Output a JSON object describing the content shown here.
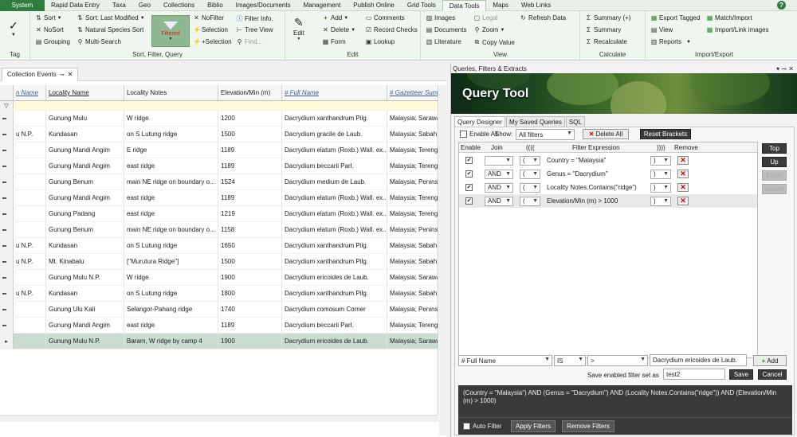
{
  "menu": {
    "system": "System",
    "items": [
      "Rapid Data Entry",
      "Taxa",
      "Geo",
      "Collections",
      "Biblio",
      "Images/Documents",
      "Management",
      "Publish Online",
      "Grid Tools",
      "Data Tools",
      "Maps",
      "Web Links"
    ],
    "active_index": 9,
    "help": "?"
  },
  "ribbon": {
    "tag": {
      "label": "Tag"
    },
    "sort": {
      "label": "Sort, Filter, Query",
      "sort": "Sort",
      "nosort": "NoSort",
      "grouping": "Grouping",
      "sort_last_modified": "Sort: Last Modified",
      "natural_species_sort": "Natural Species Sort",
      "multi_search": "Multi-Search",
      "filtered": "Filtered",
      "nofilter": "NoFilter",
      "selection": "Selection",
      "plus_selection": "+Selection",
      "filter_info": "Filter Info.",
      "tree_view": "Tree View",
      "find": "Find..."
    },
    "edit": {
      "label": "Edit",
      "edit": "Edit",
      "add": "Add",
      "delete": "Delete",
      "form": "Form",
      "comments": "Comments",
      "record_checks": "Record Checks",
      "lookup": "Lookup"
    },
    "view": {
      "label": "View",
      "images": "Images",
      "documents": "Documents",
      "literature": "Literature",
      "legal": "Legal",
      "zoom": "Zoom",
      "copy_value": "Copy Value",
      "refresh_data": "Refresh Data"
    },
    "calculate": {
      "label": "Calculate",
      "summary_plus": "Summary (+)",
      "summary": "Summary",
      "recalculate": "Recalculate"
    },
    "import_export": {
      "label": "Import/Export",
      "export_tagged": "Export Tagged",
      "view": "View",
      "reports": "Reports",
      "match_import": "Match/Import",
      "import_link_images": "Import/Link images"
    }
  },
  "left_panel": {
    "tab_title": "Collection Events",
    "columns": [
      "n Name",
      "Locality Name",
      "Locality Notes",
      "Elevation/Min (m)",
      "# Full Name",
      "# Gazetteer Summ"
    ],
    "rows": [
      {
        "c0": "",
        "c1": "Gunung Mulu",
        "c2": "W ridge",
        "c3": "1200",
        "c4": "Dacrydium xanthandrum Pilg.",
        "c5": "Malaysia; Sarawal"
      },
      {
        "c0": "u N.P.",
        "c1": "Kundasan",
        "c2": "on S Lutung ridge",
        "c3": "1500",
        "c4": "Dacrydium gracile de Laub.",
        "c5": "Malaysia; Sabah;"
      },
      {
        "c0": "",
        "c1": "Gunung Mandi Angim",
        "c2": "E ridge",
        "c3": "1189",
        "c4": "Dacrydium elatum (Roxb.) Wall. ex...",
        "c5": "Malaysia; Tereng"
      },
      {
        "c0": "",
        "c1": "Gunung Mandi Angim",
        "c2": "east ridge",
        "c3": "1189",
        "c4": "Dacrydium beccarii Parl.",
        "c5": "Malaysia; Tereng"
      },
      {
        "c0": "",
        "c1": "Gunung Benum",
        "c2": "main NE ridge on boundary o...",
        "c3": "1524",
        "c4": "Dacrydium medium de Laub.",
        "c5": "Malaysia; Peninsu"
      },
      {
        "c0": "",
        "c1": "Gunung Mandi Angim",
        "c2": "east ridge",
        "c3": "1189",
        "c4": "Dacrydium elatum (Roxb.) Wall. ex...",
        "c5": "Malaysia; Tereng"
      },
      {
        "c0": "",
        "c1": "Gunung Padang",
        "c2": "east ridge",
        "c3": "1219",
        "c4": "Dacrydium elatum (Roxb.) Wall. ex...",
        "c5": "Malaysia; Tereng"
      },
      {
        "c0": "",
        "c1": "Gunung Benum",
        "c2": "main NE ridge on boundary o...",
        "c3": "1158",
        "c4": "Dacrydium elatum (Roxb.) Wall. ex...",
        "c5": "Malaysia; Peninsu"
      },
      {
        "c0": "u N.P.",
        "c1": "Kundasan",
        "c2": "on S Lutung ridge",
        "c3": "1650",
        "c4": "Dacrydium xanthandrum Pilg.",
        "c5": "Malaysia; Sabah;"
      },
      {
        "c0": "u N.P.",
        "c1": "Mt. Kinabalu",
        "c2": "[\"Murutura Ridge\"]",
        "c3": "1500",
        "c4": "Dacrydium xanthandrum Pilg.",
        "c5": "Malaysia; Sabah;"
      },
      {
        "c0": "",
        "c1": "Gunung Mulu N.P.",
        "c2": "W ridge",
        "c3": "1900",
        "c4": "Dacrydium ericoides de Laub.",
        "c5": "Malaysia; Sarawal"
      },
      {
        "c0": "u N.P.",
        "c1": "Kundasan",
        "c2": "on S Lutung ridge",
        "c3": "1800",
        "c4": "Dacrydium xanthandrum Pilg.",
        "c5": "Malaysia; Sabah;"
      },
      {
        "c0": "",
        "c1": "Gunung Ulu Kali",
        "c2": "Selangor-Pahang ridge",
        "c3": "1740",
        "c4": "Dacrydium comosum Corner",
        "c5": "Malaysia; Peninsu"
      },
      {
        "c0": "",
        "c1": "Gunung Mandi Angim",
        "c2": "east ridge",
        "c3": "1189",
        "c4": "Dacrydium beccarii Parl.",
        "c5": "Malaysia; Tereng"
      },
      {
        "c0": "",
        "c1": "Gunung Mulu N.P.",
        "c2": "Baram, W ridge by camp 4",
        "c3": "1900",
        "c4": "Dacrydium ericoides de Laub.",
        "c5": "Malaysia; Sarawal"
      }
    ],
    "selected_row": 14
  },
  "query_tool": {
    "window_title": "Queries, Filters & Extracts",
    "heading": "Query Tool",
    "tabs": [
      "Query Designer",
      "My Saved Queries",
      "SQL"
    ],
    "enable_all_label": "Enable All",
    "show_label": "Show:",
    "show_value": "All filters",
    "delete_all": "Delete All",
    "reset_brackets": "Reset Brackets",
    "columns": [
      "Enable",
      "Join",
      "((((",
      "Filter Expression",
      "))))",
      "Remove"
    ],
    "filters": [
      {
        "join": "",
        "open": "(",
        "expr": "Country = \"Malaysia\"",
        "close": ")"
      },
      {
        "join": "AND",
        "open": "(",
        "expr": "Genus = \"Dacrydium\"",
        "close": ")"
      },
      {
        "join": "AND",
        "open": "(",
        "expr": "Locality Notes.Contains(\"ridge\")",
        "close": ")"
      },
      {
        "join": "AND",
        "open": "(",
        "expr": "Elevation/Min (m)  > 1000",
        "close": ")"
      }
    ],
    "side_buttons": [
      "Top",
      "Up",
      "Down",
      "Bottom"
    ],
    "builder": {
      "field": "# Full Name",
      "op1": "IS",
      "op2": ">",
      "value": "Dacrydium ericoides de Laub.",
      "add": "Add"
    },
    "save_label": "Save enabled filter set as",
    "save_value": "test2",
    "save": "Save",
    "cancel": "Cancel",
    "expression": "(Country = \"Malaysia\") AND (Genus = \"Dacrydium\") AND (Locality Notes.Contains(\"ridge\")) AND (Elevation/Min (m)  > 1000)",
    "auto_filter": "Auto Filter",
    "apply_filters": "Apply Filters",
    "remove_filters": "Remove Filters"
  }
}
